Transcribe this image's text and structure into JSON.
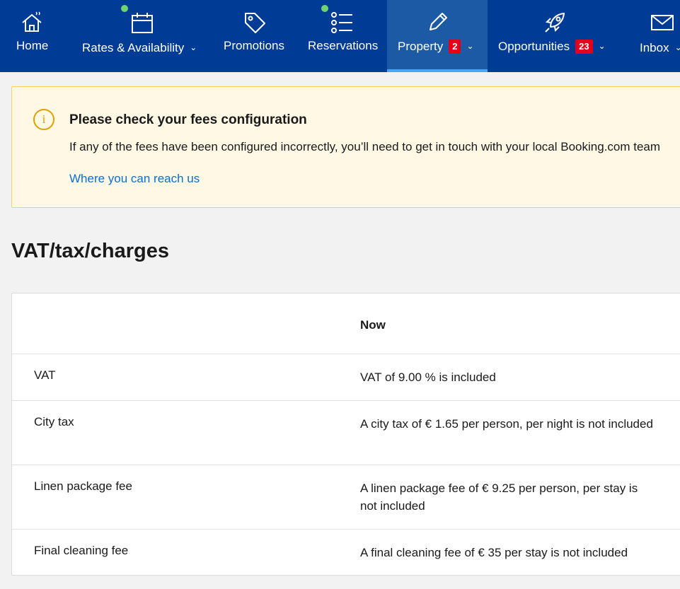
{
  "nav": {
    "items": [
      {
        "label": "Home",
        "icon": "home-icon"
      },
      {
        "label": "Rates & Availability",
        "icon": "calendar-icon"
      },
      {
        "label": "Promotions",
        "icon": "tag-icon"
      },
      {
        "label": "Reservations",
        "icon": "list-icon"
      },
      {
        "label": "Property",
        "icon": "pencil-icon",
        "badge": "2"
      },
      {
        "label": "Opportunities",
        "icon": "rocket-icon",
        "badge": "23"
      },
      {
        "label": "Inbox",
        "icon": "envelope-icon"
      }
    ],
    "active": "Property",
    "colors": {
      "background": "#003b95",
      "active": "#1d5aa6",
      "indicator": "#4aa3ff",
      "badge": "#e4001b",
      "dot": "#6fd36f"
    }
  },
  "banner": {
    "title": "Please check your fees configuration",
    "text": "If any of the fees have been configured incorrectly, you’ll need to get in touch with your local Booking.com team",
    "link": "Where you can reach us",
    "icon": "info-icon"
  },
  "page": {
    "title": "VAT/tax/charges"
  },
  "table": {
    "header": {
      "col1": "",
      "col2": "Now"
    },
    "rows": [
      {
        "name": "VAT",
        "value": "VAT of 9.00 % is included"
      },
      {
        "name": "City tax",
        "value": "A city tax of € 1.65 per person, per night is not included"
      },
      {
        "name": "Linen package fee",
        "value": "A linen package fee of € 9.25 per person, per stay is not included"
      },
      {
        "name": "Final cleaning fee",
        "value": "A final cleaning fee of € 35 per stay is not included"
      }
    ]
  }
}
